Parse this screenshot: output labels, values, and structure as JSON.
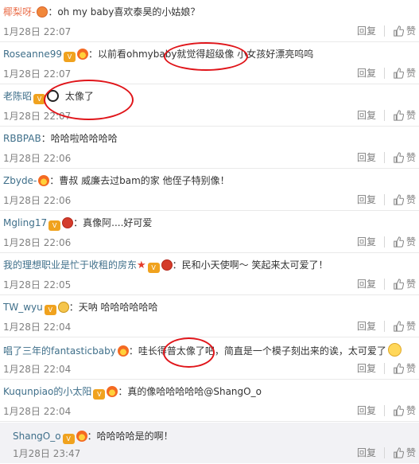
{
  "comments": [
    {
      "user": "椰梨呀-",
      "icons": [
        "orange"
      ],
      "text": "：oh my baby喜欢泰昊的小姑娘？",
      "time": "1月28日 22:07"
    },
    {
      "user": "Roseanne99",
      "icons": [
        "badge",
        "fire"
      ],
      "text": "：以前看ohmybaby就觉得超级像 小女孩好漂亮呜呜",
      "time": "1月28日 22:07"
    },
    {
      "user": "老陈昭",
      "icons": [
        "badge",
        "panda"
      ],
      "text": "太像了",
      "time": "1月28日 22:07"
    },
    {
      "user": "RBBPAB",
      "icons": [],
      "text": "：哈哈啦哈哈哈哈",
      "time": "1月28日 22:06"
    },
    {
      "user": "Zbyde-",
      "icons": [
        "fire"
      ],
      "text": "：曹叔 威廉去过bam的家 他侄子特别像！",
      "time": "1月28日 22:06"
    },
    {
      "user": "Mgling17",
      "icons": [
        "badge",
        "red"
      ],
      "text": "：真像阿....好可爱",
      "time": "1月28日 22:06"
    },
    {
      "user": "我的理想职业是忙于收租的房东",
      "icons": [
        "star",
        "badge",
        "red"
      ],
      "text": "：民和小天使啊～ 笑起来太可爱了！",
      "time": "1月28日 22:05"
    },
    {
      "user": "TW_wyu",
      "icons": [
        "badge",
        "gold"
      ],
      "text": "：天呐 哈哈哈哈哈哈",
      "time": "1月28日 22:04"
    },
    {
      "user": "唱了三年的fantasticbaby",
      "icons": [
        "fire"
      ],
      "text": "：哇长得普太像了吧，简直是一个模子刻出来的诶，太可爱了",
      "time": "1月28日 22:04"
    },
    {
      "user": "Kuqunpiao的小太阳",
      "icons": [
        "badge",
        "fire"
      ],
      "text": "：真的像哈哈哈哈哈@ShangO_o",
      "time": "1月28日 22:04"
    }
  ],
  "reply": {
    "user": "ShangO_o",
    "icons": [
      "badge",
      "fire"
    ],
    "text": "：哈哈哈哈是的啊！",
    "time": "1月28日 23:47"
  },
  "labels": {
    "reply": "回复",
    "like": "赞"
  },
  "colors": {
    "username": "#eb7350",
    "annotation": "#e0151a"
  }
}
